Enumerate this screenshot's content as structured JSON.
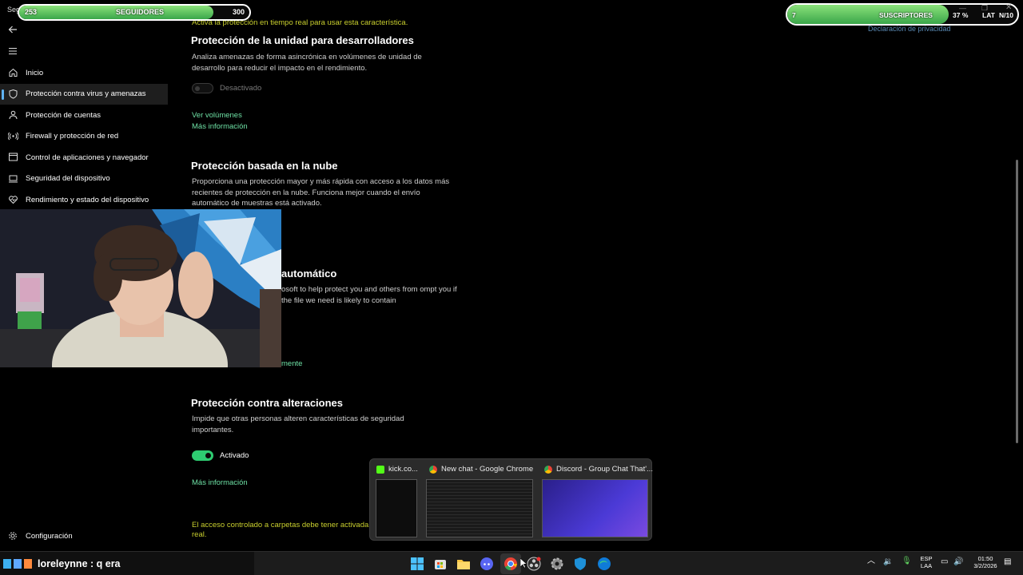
{
  "app": {
    "title": "Seguridad de Windows"
  },
  "sidebar": {
    "items": [
      {
        "label": "Inicio",
        "icon": "home-icon"
      },
      {
        "label": "Protección contra virus y amenazas",
        "icon": "shield-icon",
        "active": true
      },
      {
        "label": "Protección de cuentas",
        "icon": "person-icon"
      },
      {
        "label": "Firewall y protección de red",
        "icon": "wifi-antenna-icon"
      },
      {
        "label": "Control de aplicaciones y navegador",
        "icon": "app-window-icon"
      },
      {
        "label": "Seguridad del dispositivo",
        "icon": "laptop-icon"
      },
      {
        "label": "Rendimiento y estado del dispositivo",
        "icon": "heart-icon"
      }
    ],
    "settings_label": "Configuración"
  },
  "main": {
    "top_warning": "Activa la protección en tiempo real para usar esta característica.",
    "privacy_link": "Declaración de privacidad",
    "dev_drive": {
      "title": "Protección de la unidad para desarrolladores",
      "description": "Analiza amenazas de forma asincrónica en volúmenes de unidad de desarrollo para reducir el impacto en el rendimiento.",
      "toggle_label": "Desactivado",
      "toggle_state": "off",
      "link1": "Ver volúmenes",
      "link2": "Más información"
    },
    "cloud": {
      "title": "Protección basada en la nube",
      "description": "Proporciona una protección mayor y más rápida con acceso a los datos más recientes de protección en la nube. Funciona mejor cuando el envío automático de muestras está activado."
    },
    "sample": {
      "title_fragment": "automático",
      "description_fragment": "osoft to help protect you and others from ompt you if the file we need is likely to contain",
      "link_fragment": "mente"
    },
    "tamper": {
      "title": "Protección contra alteraciones",
      "description": "Impide que otras personas alteren características de seguridad importantes.",
      "toggle_label": "Activado",
      "toggle_state": "on",
      "link": "Más información"
    },
    "bottom_warning_line1": "El acceso controlado a carpetas debe tener activada la",
    "bottom_warning_line2": "real."
  },
  "overlays": {
    "followers": {
      "current": "253",
      "label": "SEGUIDORES",
      "goal": "300",
      "progress": 0.843
    },
    "subscribers": {
      "current": "7",
      "label": "SUSCRIPTORES",
      "percent": "37 %",
      "lat": "LAT",
      "n": "N/10",
      "progress": 0.7
    }
  },
  "thumbnails": [
    {
      "title": "kick.co...",
      "favicon": "kick-icon"
    },
    {
      "title": "New chat - Google Chrome",
      "favicon": "chrome-icon"
    },
    {
      "title": "Discord - Group Chat That'...",
      "favicon": "chrome-icon"
    }
  ],
  "taskbar": {
    "chat_message": "loreleynne : q era",
    "language_line1": "ESP",
    "language_line2": "LAA",
    "time": "01:50",
    "date": "3/2/2026",
    "icons": [
      "windows-start-icon",
      "store-icon",
      "file-explorer-icon",
      "discord-icon",
      "chrome-icon",
      "obs-icon",
      "settings-icon",
      "defender-icon",
      "edge-icon"
    ]
  },
  "colors": {
    "accent_green": "#6ee1a5",
    "toggle_on": "#2ecc71",
    "warning_yellow": "#c9cf2e",
    "progress_green": "#3aa64a",
    "nav_active_indicator": "#5fb2f2"
  }
}
